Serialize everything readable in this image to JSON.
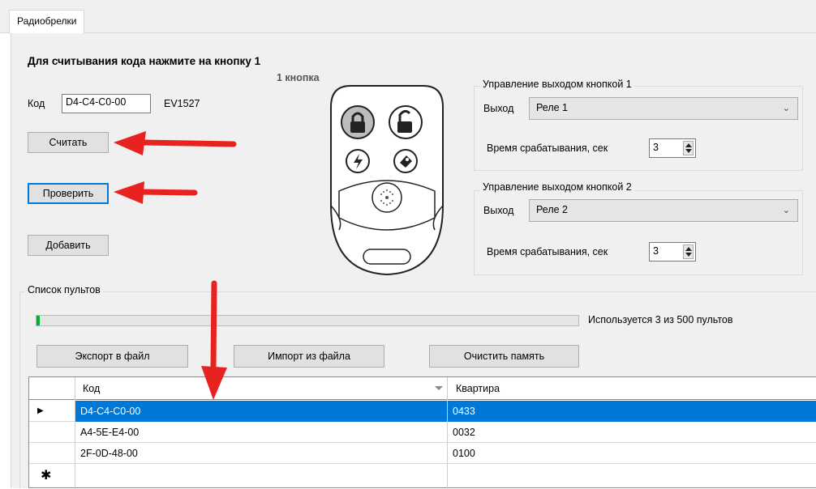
{
  "tab": {
    "label": "Радиобрелки"
  },
  "read_prompt": "Для считывания кода нажмите на кнопку 1",
  "remote_image_label": "1 кнопка",
  "code": {
    "label": "Код",
    "value": "D4-C4-C0-00",
    "protocol": "EV1527"
  },
  "buttons": {
    "read": "Считать",
    "check": "Проверить",
    "add": "Добавить",
    "export": "Экспорт в файл",
    "import": "Импорт из файла",
    "clear": "Очистить память"
  },
  "output_control_1": {
    "title": "Управление выходом кнопкой 1",
    "output_label": "Выход",
    "output_value": "Реле 1",
    "time_label": "Время срабатывания, сек",
    "time_value": "3"
  },
  "output_control_2": {
    "title": "Управление выходом кнопкой 2",
    "output_label": "Выход",
    "output_value": "Реле 2",
    "time_label": "Время срабатывания, сек",
    "time_value": "3"
  },
  "remotes_list": {
    "title": "Список пультов",
    "usage_text": "Используется 3 из 500 пультов",
    "used": 3,
    "capacity": 500,
    "columns": {
      "code": "Код",
      "flat": "Квартира"
    },
    "rows": [
      {
        "code": "D4-C4-C0-00",
        "flat": "0433",
        "selected": true
      },
      {
        "code": "A4-5E-E4-00",
        "flat": "0032",
        "selected": false
      },
      {
        "code": "2F-0D-48-00",
        "flat": "0100",
        "selected": false
      }
    ],
    "new_row_marker": "✱",
    "current_row_marker": "▶"
  },
  "colors": {
    "selection": "#0078d7",
    "progress_fill": "#06b025",
    "annotation_arrow": "#e8231f",
    "panel_bg": "#f0f0f0"
  }
}
